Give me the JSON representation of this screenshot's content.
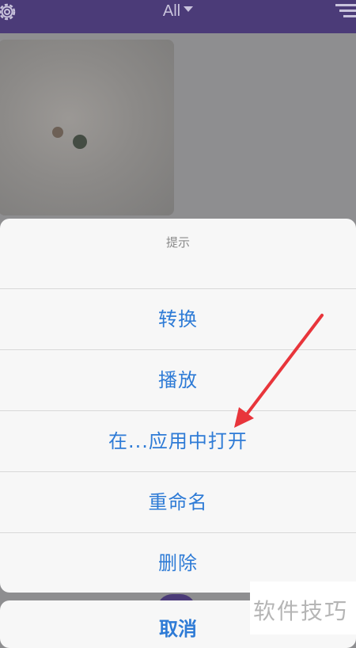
{
  "header": {
    "title": "All",
    "settings_icon": "gear-icon",
    "filter_icon": "filter-icon"
  },
  "sheet": {
    "title": "提示",
    "actions": [
      {
        "label": "转换"
      },
      {
        "label": "播放"
      },
      {
        "label": "在...应用中打开"
      },
      {
        "label": "重命名"
      },
      {
        "label": "删除"
      }
    ],
    "cancel_label": "取消"
  },
  "watermark": "软件技巧",
  "colors": {
    "header_bg": "#4b3b78",
    "action_text": "#2e7bd6",
    "arrow": "#e8353b"
  }
}
